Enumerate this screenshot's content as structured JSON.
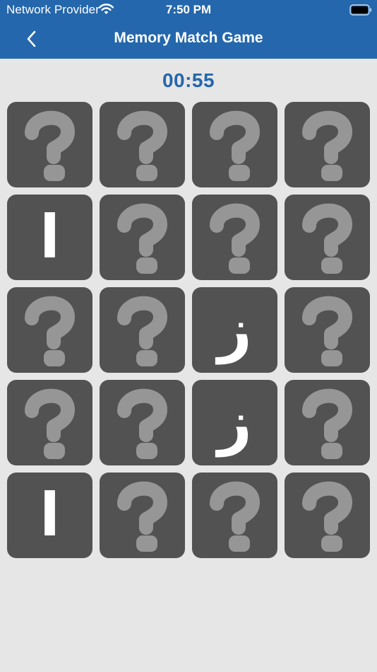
{
  "status_bar": {
    "carrier": "Network Provider",
    "time": "7:50 PM",
    "wifi_icon": "wifi-icon",
    "battery_icon": "battery-icon"
  },
  "nav": {
    "title": "Memory Match Game",
    "back_icon": "chevron-left-icon"
  },
  "game": {
    "timer": "00:55",
    "hidden_icon": "question-mark-icon",
    "cards": [
      {
        "revealed": false,
        "letter": ""
      },
      {
        "revealed": false,
        "letter": ""
      },
      {
        "revealed": false,
        "letter": ""
      },
      {
        "revealed": false,
        "letter": ""
      },
      {
        "revealed": true,
        "letter": "ا"
      },
      {
        "revealed": false,
        "letter": ""
      },
      {
        "revealed": false,
        "letter": ""
      },
      {
        "revealed": false,
        "letter": ""
      },
      {
        "revealed": false,
        "letter": ""
      },
      {
        "revealed": false,
        "letter": ""
      },
      {
        "revealed": true,
        "letter": "ز"
      },
      {
        "revealed": false,
        "letter": ""
      },
      {
        "revealed": false,
        "letter": ""
      },
      {
        "revealed": false,
        "letter": ""
      },
      {
        "revealed": true,
        "letter": "ز"
      },
      {
        "revealed": false,
        "letter": ""
      },
      {
        "revealed": true,
        "letter": "ا"
      },
      {
        "revealed": false,
        "letter": ""
      },
      {
        "revealed": false,
        "letter": ""
      },
      {
        "revealed": false,
        "letter": ""
      }
    ]
  },
  "colors": {
    "accent": "#2467ad",
    "card_background": "#525252",
    "question_mark": "#969696",
    "page_background": "#e6e6e6"
  }
}
